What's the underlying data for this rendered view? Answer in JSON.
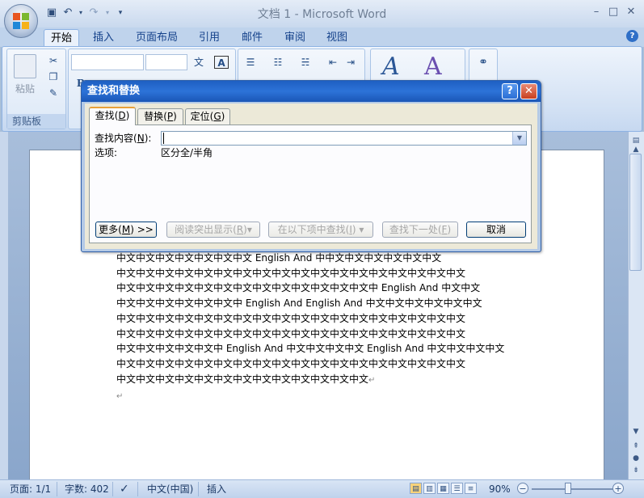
{
  "window": {
    "title": "文档 1 - Microsoft Word",
    "controls": {
      "minimize": "–",
      "maximize": "□",
      "close": "✕"
    }
  },
  "ribbon": {
    "tabs": [
      "开始",
      "插入",
      "页面布局",
      "引用",
      "邮件",
      "审阅",
      "视图"
    ],
    "active_tab": "开始",
    "clipboard": {
      "paste_label": "粘贴",
      "group_label": "剪贴板"
    },
    "font_size_label": "A"
  },
  "dialog": {
    "title": "查找和替换",
    "help": "?",
    "close": "✕",
    "tabs": [
      {
        "label": "查找",
        "key": "D"
      },
      {
        "label": "替换",
        "key": "P"
      },
      {
        "label": "定位",
        "key": "G"
      }
    ],
    "find_label": "查找内容",
    "find_key": "N",
    "find_value": "",
    "options_label": "选项:",
    "options_value": "区分全/半角",
    "buttons": {
      "more": "更多",
      "more_key": "M",
      "more_suffix": ">>",
      "reading_highlight": "阅读突出显示",
      "reading_key": "R",
      "find_in": "在以下项中查找",
      "find_in_key": "I",
      "find_next": "查找下一处",
      "find_next_key": "F",
      "cancel": "取消"
    }
  },
  "document": {
    "lines": [
      "中文中文中文中文中文中文中文 English And 中中文中文中文中文中文中文",
      "中文中文中文中文中文中文中文中文中文中文中文中文中文中文中文中文中文中文",
      "中文中文中文中文中文中文中文中文中文中文中文中文中文中 English And 中文中文",
      "中文中文中文中文中文中文中 English And English And 中文中文中文中文中文中文",
      "中文中文中文中文中文中文中文中文中文中文中文中文中文中文中文中文中文中文",
      "中文中文中文中文中文中文中文中文中文中文中文中文中文中文中文中文中文中文",
      "中文中文中文中文中文中 English And 中文中文中文中文 English And 中文中文中文中文",
      "中文中文中文中文中文中文中文中文中文中文中文中文中文中文中文中文中文中文",
      "中文中文中文中文中文中文中文中文中文中文中文中文中文"
    ],
    "para_mark": "↵"
  },
  "statusbar": {
    "page": "页面: 1/1",
    "words": "字数: 402",
    "language": "中文(中国)",
    "mode": "插入",
    "zoom": "90%",
    "zoom_level": 0.9
  }
}
